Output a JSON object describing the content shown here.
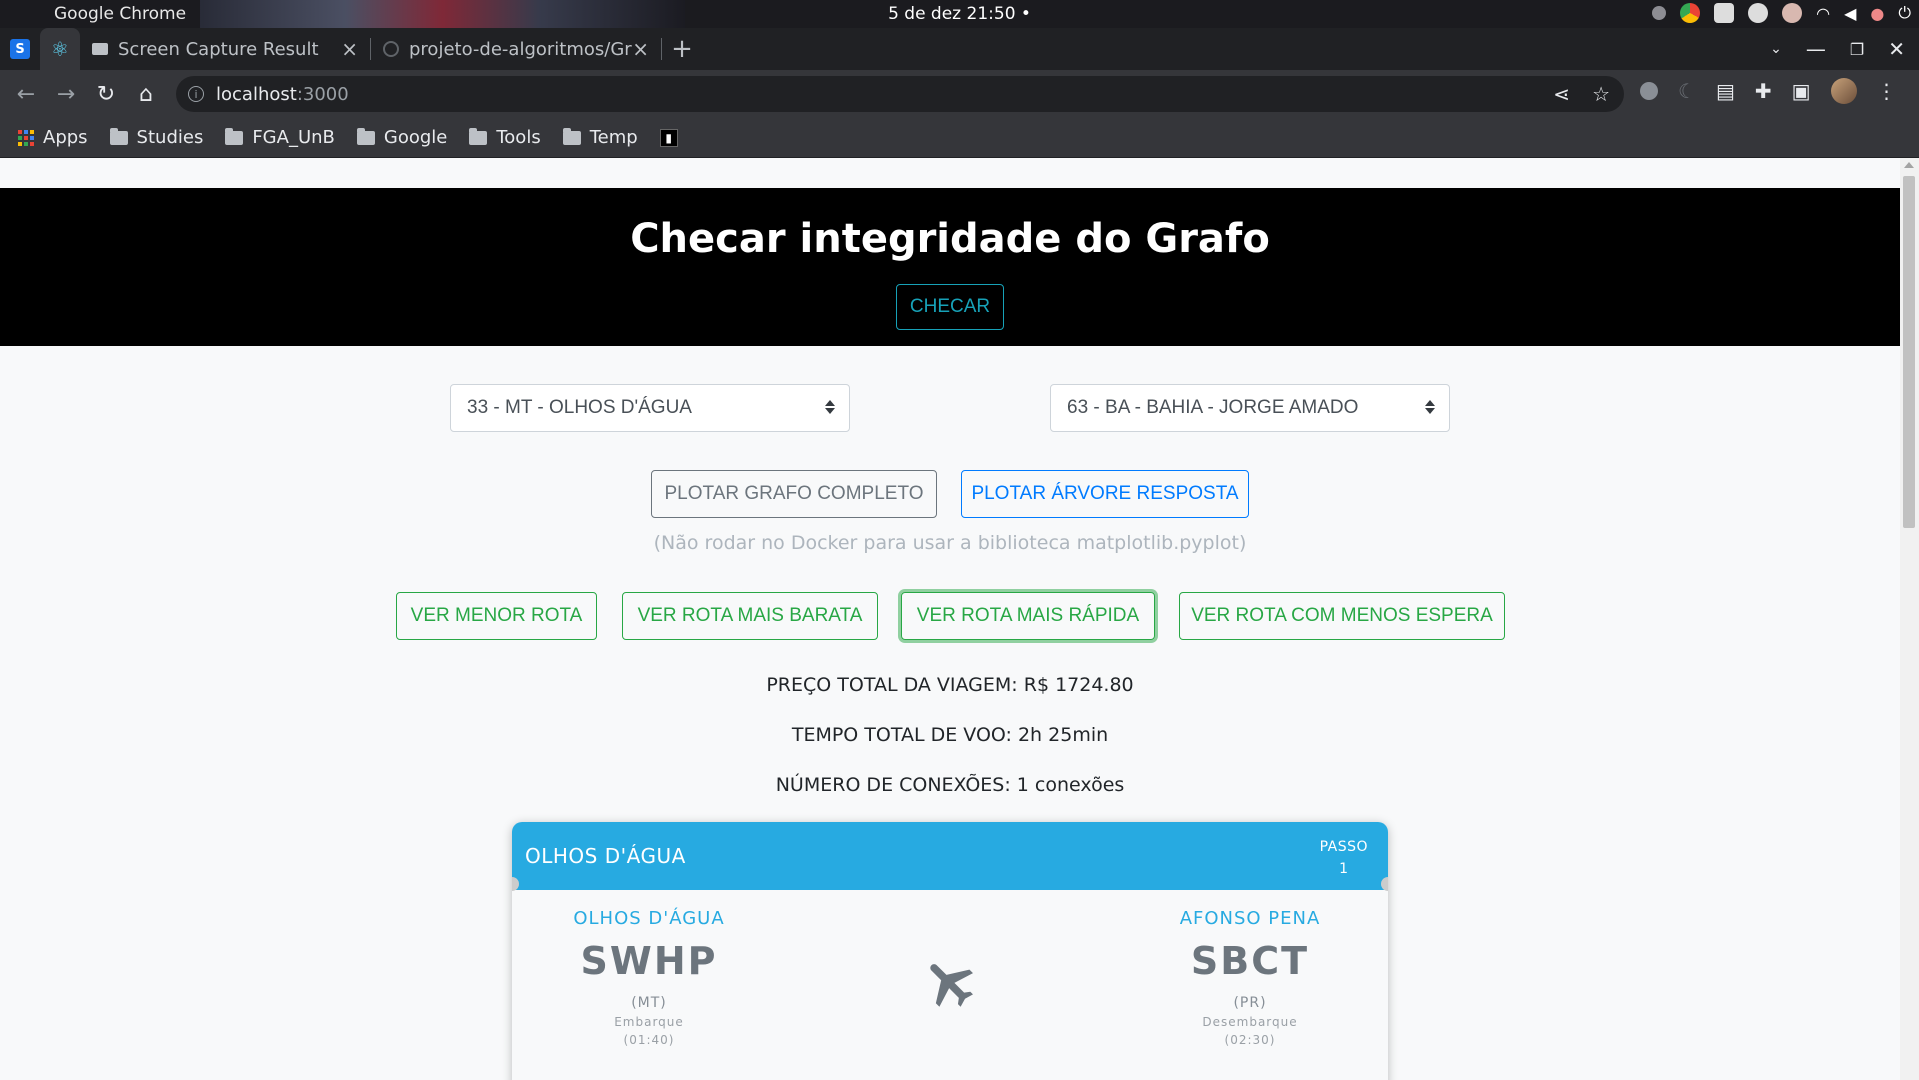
{
  "os": {
    "app_name": "Google Chrome",
    "clock": "5 de dez  21:50 •"
  },
  "browser": {
    "pinned_tabs": [
      {
        "icon": "s-favicon",
        "label": "S"
      },
      {
        "icon": "react-icon",
        "label": "⚛"
      }
    ],
    "tabs": [
      {
        "title": "Screen Capture Result",
        "icon": "camera-icon"
      },
      {
        "title": "projeto-de-algoritmos/Gr",
        "icon": "github-icon"
      }
    ],
    "url_host": "localhost",
    "url_port": ":3000",
    "bookmarks": [
      {
        "label": "Apps",
        "icon": "apps-grid-icon"
      },
      {
        "label": "Studies",
        "icon": "folder-icon"
      },
      {
        "label": "FGA_UnB",
        "icon": "folder-icon"
      },
      {
        "label": "Google",
        "icon": "folder-icon"
      },
      {
        "label": "Tools",
        "icon": "folder-icon"
      },
      {
        "label": "Temp",
        "icon": "folder-icon"
      }
    ]
  },
  "hero": {
    "title": "Checar integridade do Grafo",
    "check_button": "CHECAR"
  },
  "selects": {
    "origin": "33 - MT - OLHOS D'ÁGUA",
    "destination": "63 - BA - BAHIA - JORGE AMADO"
  },
  "plot_buttons": {
    "full_graph": "PLOTAR GRAFO COMPLETO",
    "answer_tree": "PLOTAR ÁRVORE RESPOSTA",
    "hint": "(Não rodar no Docker para usar a biblioteca matplotlib.pyplot)"
  },
  "route_buttons": {
    "shortest": "VER MENOR ROTA",
    "cheapest": "VER ROTA MAIS BARATA",
    "fastest": "VER ROTA MAIS RÁPIDA",
    "least_wait": "VER ROTA COM MENOS ESPERA"
  },
  "summary": {
    "price": "PREÇO TOTAL DA VIAGEM: R$ 1724.80",
    "flight_time": "TEMPO TOTAL DE VOO: 2h 25min",
    "connections": "NÚMERO DE CONEXÕES: 1 conexões"
  },
  "step_card": {
    "header_city": "OLHOS D'ÁGUA",
    "step_label": "PASSO",
    "step_number": "1",
    "departure": {
      "name": "OLHOS D'ÁGUA",
      "code": "SWHP",
      "state": "(MT)",
      "kind": "Embarque",
      "time": "(01:40)"
    },
    "arrival": {
      "name": "AFONSO PENA",
      "code": "SBCT",
      "state": "(PR)",
      "kind": "Desembarque",
      "time": "(02:30)"
    }
  },
  "colors": {
    "accent_blue": "#27aae1",
    "info": "#17a2b8",
    "success": "#28a745",
    "primary": "#007bff",
    "secondary": "#6c757d"
  }
}
